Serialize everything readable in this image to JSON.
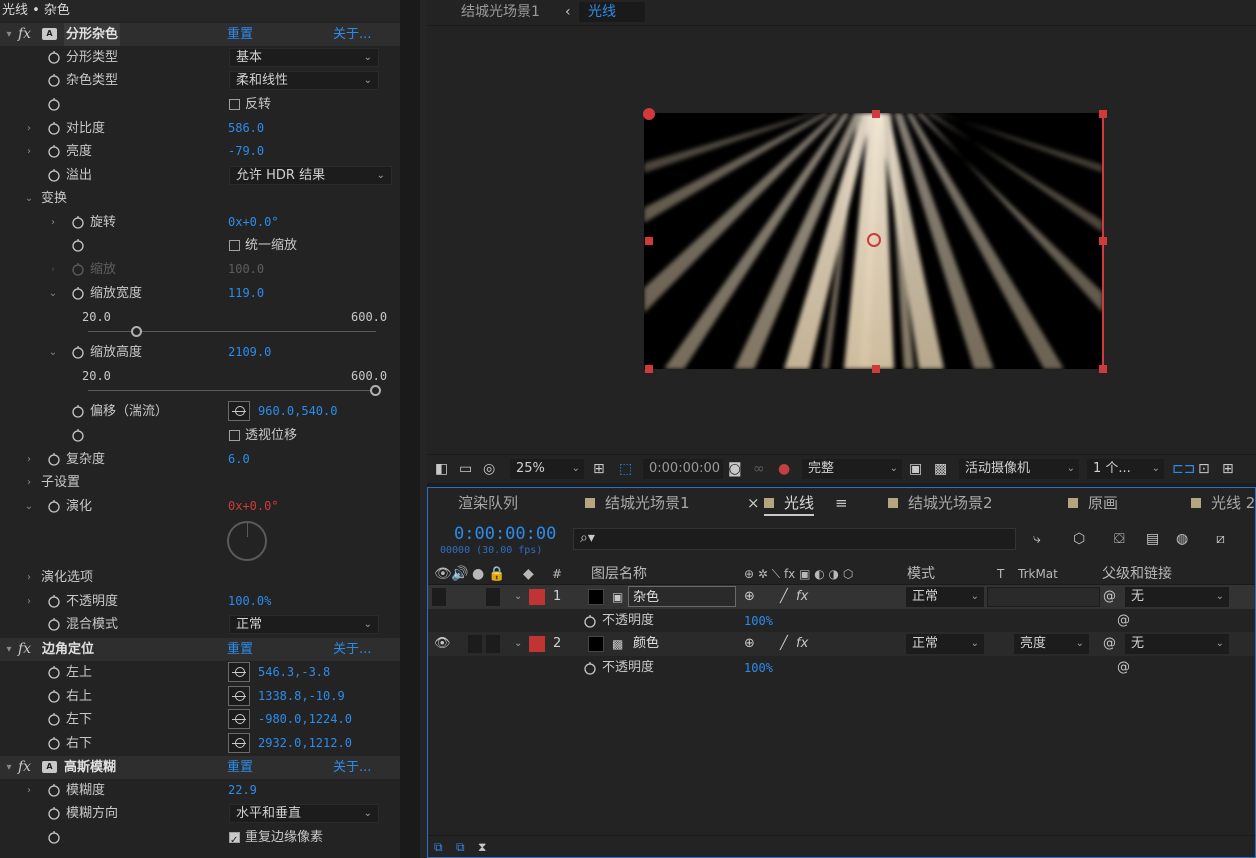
{
  "effect_controls": {
    "title": "光线 • 杂色",
    "fractal_noise": {
      "name": "分形杂色",
      "reset": "重置",
      "about": "关于...",
      "fractal_type_label": "分形类型",
      "fractal_type_value": "基本",
      "noise_type_label": "杂色类型",
      "noise_type_value": "柔和线性",
      "invert_label": "反转",
      "contrast_label": "对比度",
      "contrast_value": "586.0",
      "brightness_label": "亮度",
      "brightness_value": "-79.0",
      "overflow_label": "溢出",
      "overflow_value": "允许 HDR 结果",
      "transform_label": "变换",
      "rotation_label": "旋转",
      "rotation_value": "0x+0.0°",
      "uniform_scale_label": "统一缩放",
      "scale_label": "缩放",
      "scale_value": "100.0",
      "scale_width_label": "缩放宽度",
      "scale_width_value": "119.0",
      "scale_width_min": "20.0",
      "scale_width_max": "600.0",
      "scale_width_fraction": 0.17,
      "scale_height_label": "缩放高度",
      "scale_height_value": "2109.0",
      "scale_height_min": "20.0",
      "scale_height_max": "600.0",
      "scale_height_fraction": 1.0,
      "offset_label": "偏移（湍流）",
      "offset_value": "960.0,540.0",
      "perspective_offset_label": "透视位移",
      "complexity_label": "复杂度",
      "complexity_value": "6.0",
      "sub_settings_label": "子设置",
      "evolution_label": "演化",
      "evolution_value": "0x+0.0°",
      "evolution_options_label": "演化选项",
      "opacity_label": "不透明度",
      "opacity_value": "100.0%",
      "blend_mode_label": "混合模式",
      "blend_mode_value": "正常"
    },
    "corner_pin": {
      "name": "边角定位",
      "reset": "重置",
      "about": "关于...",
      "upper_left_label": "左上",
      "upper_left_value": "546.3,-3.8",
      "upper_right_label": "右上",
      "upper_right_value": "1338.8,-10.9",
      "lower_left_label": "左下",
      "lower_left_value": "-980.0,1224.0",
      "lower_right_label": "右下",
      "lower_right_value": "2932.0,1212.0"
    },
    "gaussian_blur": {
      "name": "高斯模糊",
      "reset": "重置",
      "about": "关于...",
      "blurriness_label": "模糊度",
      "blurriness_value": "22.9",
      "direction_label": "模糊方向",
      "direction_value": "水平和垂直",
      "repeat_edge_label": "重复边缘像素"
    }
  },
  "composition": {
    "tab_parent": "结城光场景1",
    "tab_current": "光线",
    "toolbar": {
      "zoom": "25%",
      "timecode": "0:00:00:00",
      "resolution": "完整",
      "camera": "活动摄像机",
      "views": "1 个..."
    }
  },
  "timeline": {
    "tabs": [
      "渲染队列",
      "结城光场景1",
      "光线",
      "结城光场景2",
      "原画",
      "光线 2"
    ],
    "close_glyph": "×",
    "menu_glyph": "≡",
    "timecode": "0:00:00:00",
    "fps": "00000 (30.00 fps)",
    "search_glyph": "⌕▾",
    "columns": {
      "hash": "#",
      "layer_name": "图层名称",
      "mode": "模式",
      "t": "T",
      "trkmat": "TrkMat",
      "parent": "父级和链接"
    },
    "layers": [
      {
        "index": "1",
        "name": "杂色",
        "mode": "正常",
        "trkmat": "",
        "parent": "无",
        "opacity_label": "不透明度",
        "opacity_value": "100%"
      },
      {
        "index": "2",
        "name": "颜色",
        "mode": "正常",
        "trkmat": "亮度",
        "parent": "无",
        "opacity_label": "不透明度",
        "opacity_value": "100%"
      }
    ]
  },
  "colors": {
    "accent_blue": "#2d8ceb",
    "label_red": "#c03434",
    "ray_color": "#e8dcc8"
  }
}
